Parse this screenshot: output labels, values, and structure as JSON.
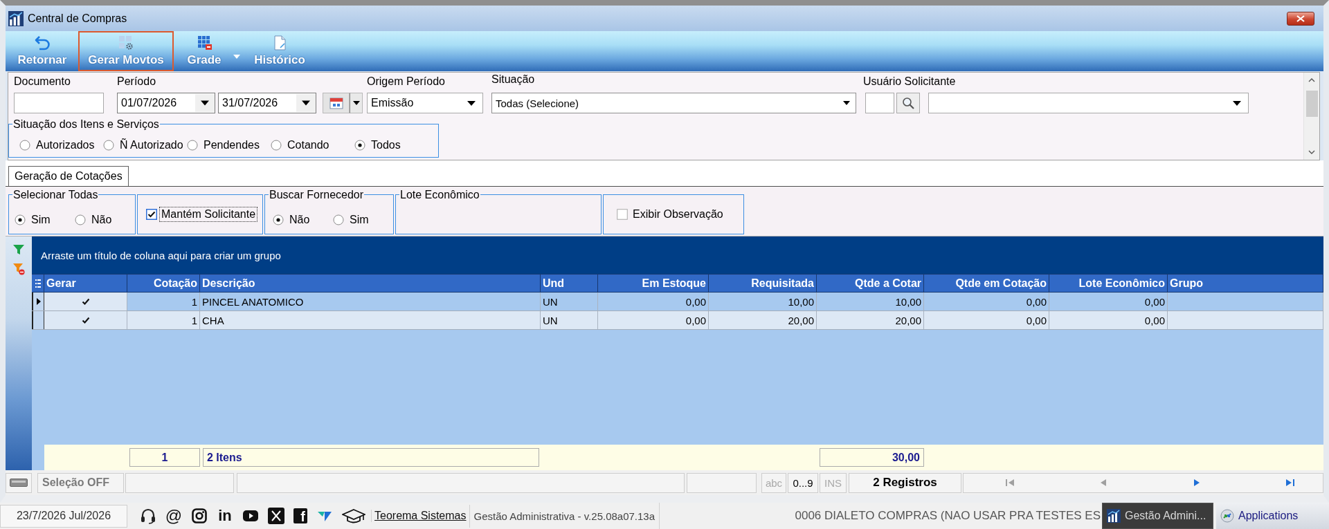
{
  "window": {
    "title": "Central de Compras"
  },
  "toolbar": [
    {
      "label": "Retornar",
      "kind": "undo",
      "focused": false,
      "dropdown": false
    },
    {
      "label": "Gerar Movtos",
      "kind": "generate",
      "focused": true,
      "dropdown": false
    },
    {
      "label": "Grade",
      "kind": "grid",
      "focused": false,
      "dropdown": true
    },
    {
      "label": "Histórico",
      "kind": "history",
      "focused": false,
      "dropdown": false
    }
  ],
  "filters": {
    "documento": {
      "label": "Documento"
    },
    "periodo": {
      "label": "Período",
      "from": "01/07/2026",
      "to": "31/07/2026"
    },
    "origem_periodo": {
      "label": "Origem Período",
      "value": "Emissão"
    },
    "situacao": {
      "label": "Situação",
      "value": "Todas (Selecione)"
    },
    "usuario_solicitante": {
      "label": "Usuário Solicitante"
    },
    "situacao_itens": {
      "title": "Situação dos Itens e Serviços",
      "options": [
        {
          "label": "Autorizados",
          "selected": false
        },
        {
          "label": "Ñ Autorizado",
          "selected": false
        },
        {
          "label": "Pendendes",
          "selected": false
        },
        {
          "label": "Cotando",
          "selected": false
        },
        {
          "label": "Todos",
          "selected": true
        }
      ]
    }
  },
  "tabs": [
    {
      "label": "Geração de Cotações",
      "selected": true
    }
  ],
  "option_groups": [
    {
      "kind": "radio",
      "title": "Selecionar Todas",
      "options": [
        {
          "label": "Sim",
          "selected": true
        },
        {
          "label": "Não",
          "selected": false
        }
      ]
    },
    {
      "kind": "check",
      "label": "Mantém Solicitante",
      "checked": true,
      "focused": true
    },
    {
      "kind": "radio",
      "title": "Buscar Fornecedor",
      "options": [
        {
          "label": "Não",
          "selected": true
        },
        {
          "label": "Sim",
          "selected": false
        }
      ]
    },
    {
      "kind": "empty",
      "title": "Lote Econômico"
    },
    {
      "kind": "check",
      "label": "Exibir Observação",
      "checked": false,
      "focused": false
    }
  ],
  "grid": {
    "group_hint": "Arraste um título de coluna aqui para criar um grupo",
    "columns": [
      {
        "label": "Gerar",
        "kind": "check"
      },
      {
        "label": "Cotação",
        "kind": "number"
      },
      {
        "label": "Descrição",
        "kind": "text"
      },
      {
        "label": "Und",
        "kind": "text"
      },
      {
        "label": "Em Estoque",
        "kind": "number"
      },
      {
        "label": "Requisitada",
        "kind": "number"
      },
      {
        "label": "Qtde a Cotar",
        "kind": "number"
      },
      {
        "label": "Qtde em Cotação",
        "kind": "number"
      },
      {
        "label": "Lote Econômico",
        "kind": "number"
      },
      {
        "label": "Grupo",
        "kind": "text"
      }
    ],
    "rows": [
      {
        "current": true,
        "selected": true,
        "cells": [
          {
            "checked": true
          },
          "1",
          "PINCEL ANATOMICO",
          "UN",
          "0,00",
          "10,00",
          "10,00",
          "0,00",
          "0,00"
        ]
      },
      {
        "current": false,
        "selected": false,
        "cells": [
          {
            "checked": true
          },
          "1",
          "CHA",
          "UN",
          "0,00",
          "20,00",
          "20,00",
          "0,00",
          "0,00"
        ]
      }
    ],
    "footer": {
      "cotacao": "1",
      "descricao": "2 Itens",
      "qtde_a_cotar": "30,00"
    }
  },
  "status_bar": {
    "selection": "Seleção OFF",
    "indicators": [
      {
        "label": "abc",
        "on": false
      },
      {
        "label": "0...9",
        "on": true
      },
      {
        "label": "INS",
        "on": false
      }
    ],
    "records": "2 Registros",
    "nav": [
      {
        "kind": "first",
        "disabled": true
      },
      {
        "kind": "prev",
        "disabled": true
      },
      {
        "kind": "next",
        "disabled": false
      },
      {
        "kind": "last",
        "disabled": false
      }
    ]
  },
  "taskbar": {
    "date": "23/7/2026 Jul/2026",
    "email_symbol": "@",
    "linkedin_logo": "in",
    "facebook_logo": "f",
    "company_link": "Teorema Sistemas",
    "app_version": "Gestão Administrativa - v.25.08a07.13a",
    "database": "0006 DIALETO COMPRAS (NAO USAR PRA TESTES ES",
    "buttons": [
      {
        "label": "Gestão Admini...",
        "kind": "app",
        "selected": true
      },
      {
        "label": "Applications",
        "kind": "launcher",
        "selected": false
      }
    ]
  }
}
